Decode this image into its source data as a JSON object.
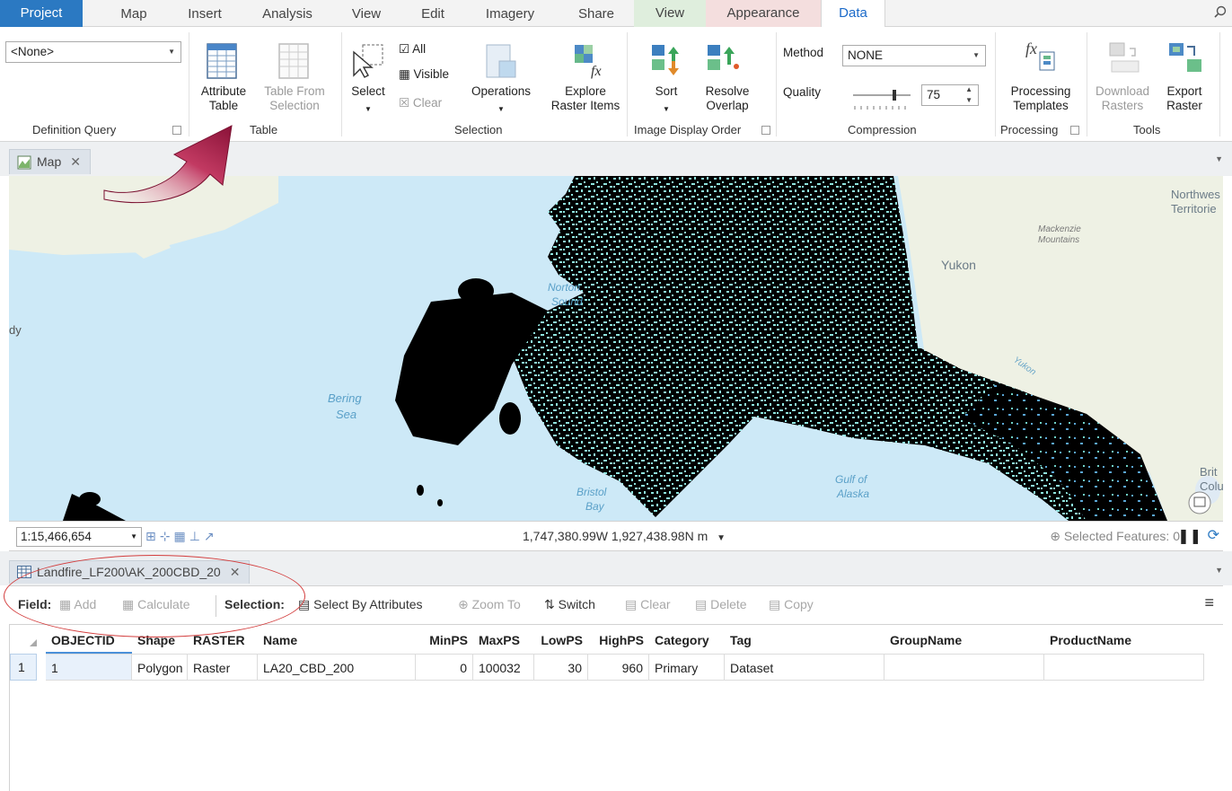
{
  "ribbon_tabs": [
    {
      "label": "Project"
    },
    {
      "label": "Map"
    },
    {
      "label": "Insert"
    },
    {
      "label": "Analysis"
    },
    {
      "label": "View"
    },
    {
      "label": "Edit"
    },
    {
      "label": "Imagery"
    },
    {
      "label": "Share"
    },
    {
      "label": "View"
    },
    {
      "label": "Appearance"
    },
    {
      "label": "Data"
    }
  ],
  "ribbon": {
    "definition_query": {
      "value": "<None>",
      "group_label": "Definition Query"
    },
    "table": {
      "attribute_table": "Attribute\nTable",
      "table_from_selection": "Table From\nSelection",
      "group_label": "Table"
    },
    "selection": {
      "select": "Select",
      "all": "All",
      "visible": "Visible",
      "clear": "Clear",
      "operations": "Operations",
      "explore": "Explore\nRaster Items",
      "group_label": "Selection"
    },
    "image_display_order": {
      "sort": "Sort",
      "resolve": "Resolve\nOverlap",
      "group_label": "Image Display Order"
    },
    "compression": {
      "method_label": "Method",
      "method_value": "NONE",
      "quality_label": "Quality",
      "quality_value": "75",
      "group_label": "Compression"
    },
    "processing": {
      "templates": "Processing\nTemplates",
      "group_label": "Processing"
    },
    "tools": {
      "download": "Download\nRasters",
      "export": "Export\nRaster",
      "group_label": "Tools"
    }
  },
  "map_view": {
    "tab_label": "Map",
    "labels": {
      "northwest": "Northwes",
      "territorie": "Territorie",
      "mackenzie": "Mackenzie",
      "mountains": "Mountains",
      "yukon": "Yukon",
      "yukon_river": "Yukon",
      "norton": "Norton",
      "sound": "Sound",
      "bering": "Bering",
      "sea": "Sea",
      "gulf": "Gulf of",
      "alaska": "Alaska",
      "bristol": "Bristol",
      "bay": "Bay",
      "brit": "Brit",
      "colu": "Colu",
      "dy": "dy"
    },
    "scale": "1:15,466,654",
    "coordinates": "1,747,380.99W 1,927,438.98N m",
    "selected_features": "Selected Features: 0"
  },
  "table_view": {
    "tab_label": "Landfire_LF200\\AK_200CBD_20",
    "toolbar": {
      "field_label": "Field:",
      "add": "Add",
      "calculate": "Calculate",
      "selection_label": "Selection:",
      "select_by_attributes": "Select By Attributes",
      "zoom_to": "Zoom To",
      "switch": "Switch",
      "clear": "Clear",
      "delete": "Delete",
      "copy": "Copy"
    },
    "columns": [
      "OBJECTID",
      "Shape",
      "RASTER",
      "Name",
      "MinPS",
      "MaxPS",
      "LowPS",
      "HighPS",
      "Category",
      "Tag",
      "GroupName",
      "ProductName"
    ],
    "rows": [
      {
        "row_number": "1",
        "cells": [
          "1",
          "Polygon",
          "Raster",
          "LA20_CBD_200",
          "0",
          "100032",
          "30",
          "960",
          "Primary",
          "Dataset",
          "",
          ""
        ]
      }
    ]
  },
  "colors": {
    "accent": "#2b79c2",
    "annotation": "#d33d3d",
    "arrow": "#b0224f"
  }
}
